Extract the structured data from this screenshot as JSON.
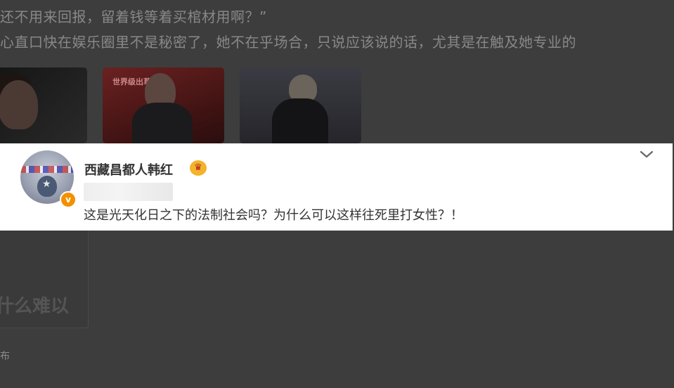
{
  "background": {
    "line1": "还不用来回报，留着钱等着买棺材用啊？”",
    "line2": "心直口快在娱乐圈里不是秘密了，她不在乎场合，只说应该说的话，尤其是在触及她专业的",
    "thumbnail_2_caption": "世界级出草人士",
    "under_card_text": "什么难以",
    "bottom_text": "布"
  },
  "comment_card": {
    "username": "西藏昌都人韩红",
    "verified_badge": "v",
    "comment_text": "这是光天化日之下的法制社会吗？为什么可以这样往死里打女性？！",
    "icons": {
      "avatar": "avatar-image",
      "badge": "verified-badge-icon",
      "crown": "crown-icon",
      "expand": "chevron-down-icon"
    }
  },
  "colors": {
    "overlay_background": "#3d3d3d",
    "card_background": "#ffffff",
    "verified_orange": "#f29100",
    "crown_gold": "#f3b32b"
  }
}
